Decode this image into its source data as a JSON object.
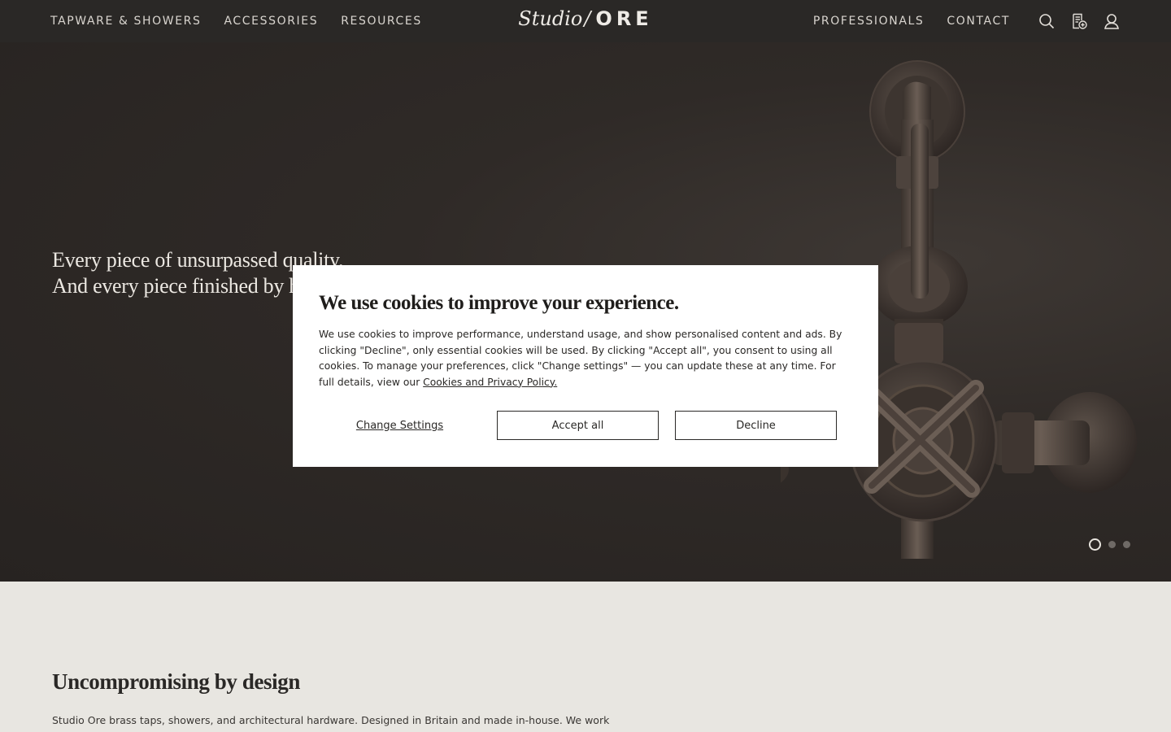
{
  "header": {
    "nav_left": [
      "TAPWARE & SHOWERS",
      "ACCESSORIES",
      "RESOURCES"
    ],
    "logo": {
      "script": "Studio",
      "slash": "/",
      "bold": "ORE"
    },
    "nav_right": [
      "PROFESSIONALS",
      "CONTACT"
    ],
    "icons": [
      "search-icon",
      "quote-list-icon",
      "account-icon"
    ]
  },
  "hero": {
    "line1": "Every piece of unsurpassed quality.",
    "line2": "And every piece finished by hand.",
    "slides": {
      "count": 3,
      "active": 1
    }
  },
  "cookie": {
    "title": "We use cookies to improve your experience.",
    "body": "We use cookies to improve performance, understand usage, and show personalised content and ads. By clicking \"Decline\", only essential cookies will be used. By clicking \"Accept all\", you consent to using all cookies. To manage your preferences, click \"Change settings\" — you can update these at any time. For full details, view our ",
    "link": "Cookies and Privacy Policy.",
    "change_settings": "Change Settings",
    "accept": "Accept all",
    "decline": "Decline"
  },
  "intro": {
    "title": "Uncompromising by design",
    "body": "Studio Ore brass taps, showers, and architectural hardware. Designed in Britain and made in-house. We work"
  },
  "colors": {
    "header_bg": "#2a2826",
    "hero_bg": "#2f2a27",
    "section_bg": "#e8e6e1",
    "modal_bg": "#ffffff"
  }
}
